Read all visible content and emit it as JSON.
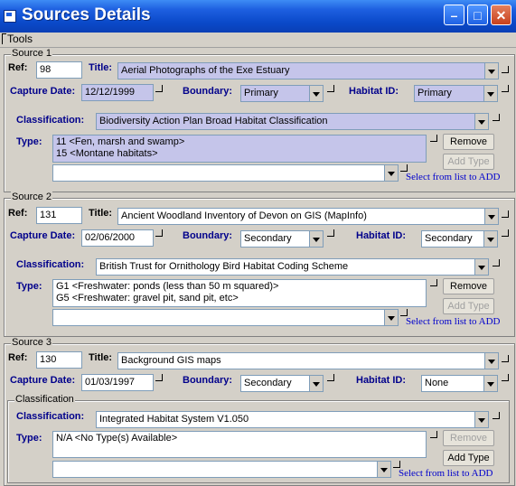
{
  "window": {
    "title": "Sources Details"
  },
  "menu": {
    "tools": "Tools"
  },
  "labels": {
    "ref": "Ref:",
    "title": "Title:",
    "capture_date": "Capture Date:",
    "boundary": "Boundary:",
    "habitat_id": "Habitat ID:",
    "classification": "Classification:",
    "type": "Type:",
    "remove": "Remove",
    "add_type": "Add Type",
    "hint": "Select from list to ADD",
    "classification_group": "Classification"
  },
  "sources": [
    {
      "group": "Source 1",
      "ref": "98",
      "title": "Aerial Photographs of the Exe Estuary",
      "capture_date": "12/12/1999",
      "boundary": "Primary",
      "habitat_id": "Primary",
      "classification": "Biodiversity Action Plan Broad Habitat Classification",
      "types": [
        "11   <Fen, marsh and swamp>",
        "15   <Montane habitats>"
      ]
    },
    {
      "group": "Source 2",
      "ref": "131",
      "title": "Ancient Woodland Inventory of Devon on GIS (MapInfo)",
      "capture_date": "02/06/2000",
      "boundary": "Secondary",
      "habitat_id": "Secondary",
      "classification": "British Trust for Ornithology Bird Habitat Coding Scheme",
      "types": [
        "G1   <Freshwater: ponds (less than 50 m squared)>",
        "G5   <Freshwater: gravel pit, sand pit, etc>"
      ]
    },
    {
      "group": "Source 3",
      "ref": "130",
      "title": "Background GIS maps",
      "capture_date": "01/03/1997",
      "boundary": "Secondary",
      "habitat_id": "None",
      "classification": "Integrated Habitat System V1.050",
      "types": [
        "N/A   <No Type(s) Available>"
      ]
    }
  ]
}
